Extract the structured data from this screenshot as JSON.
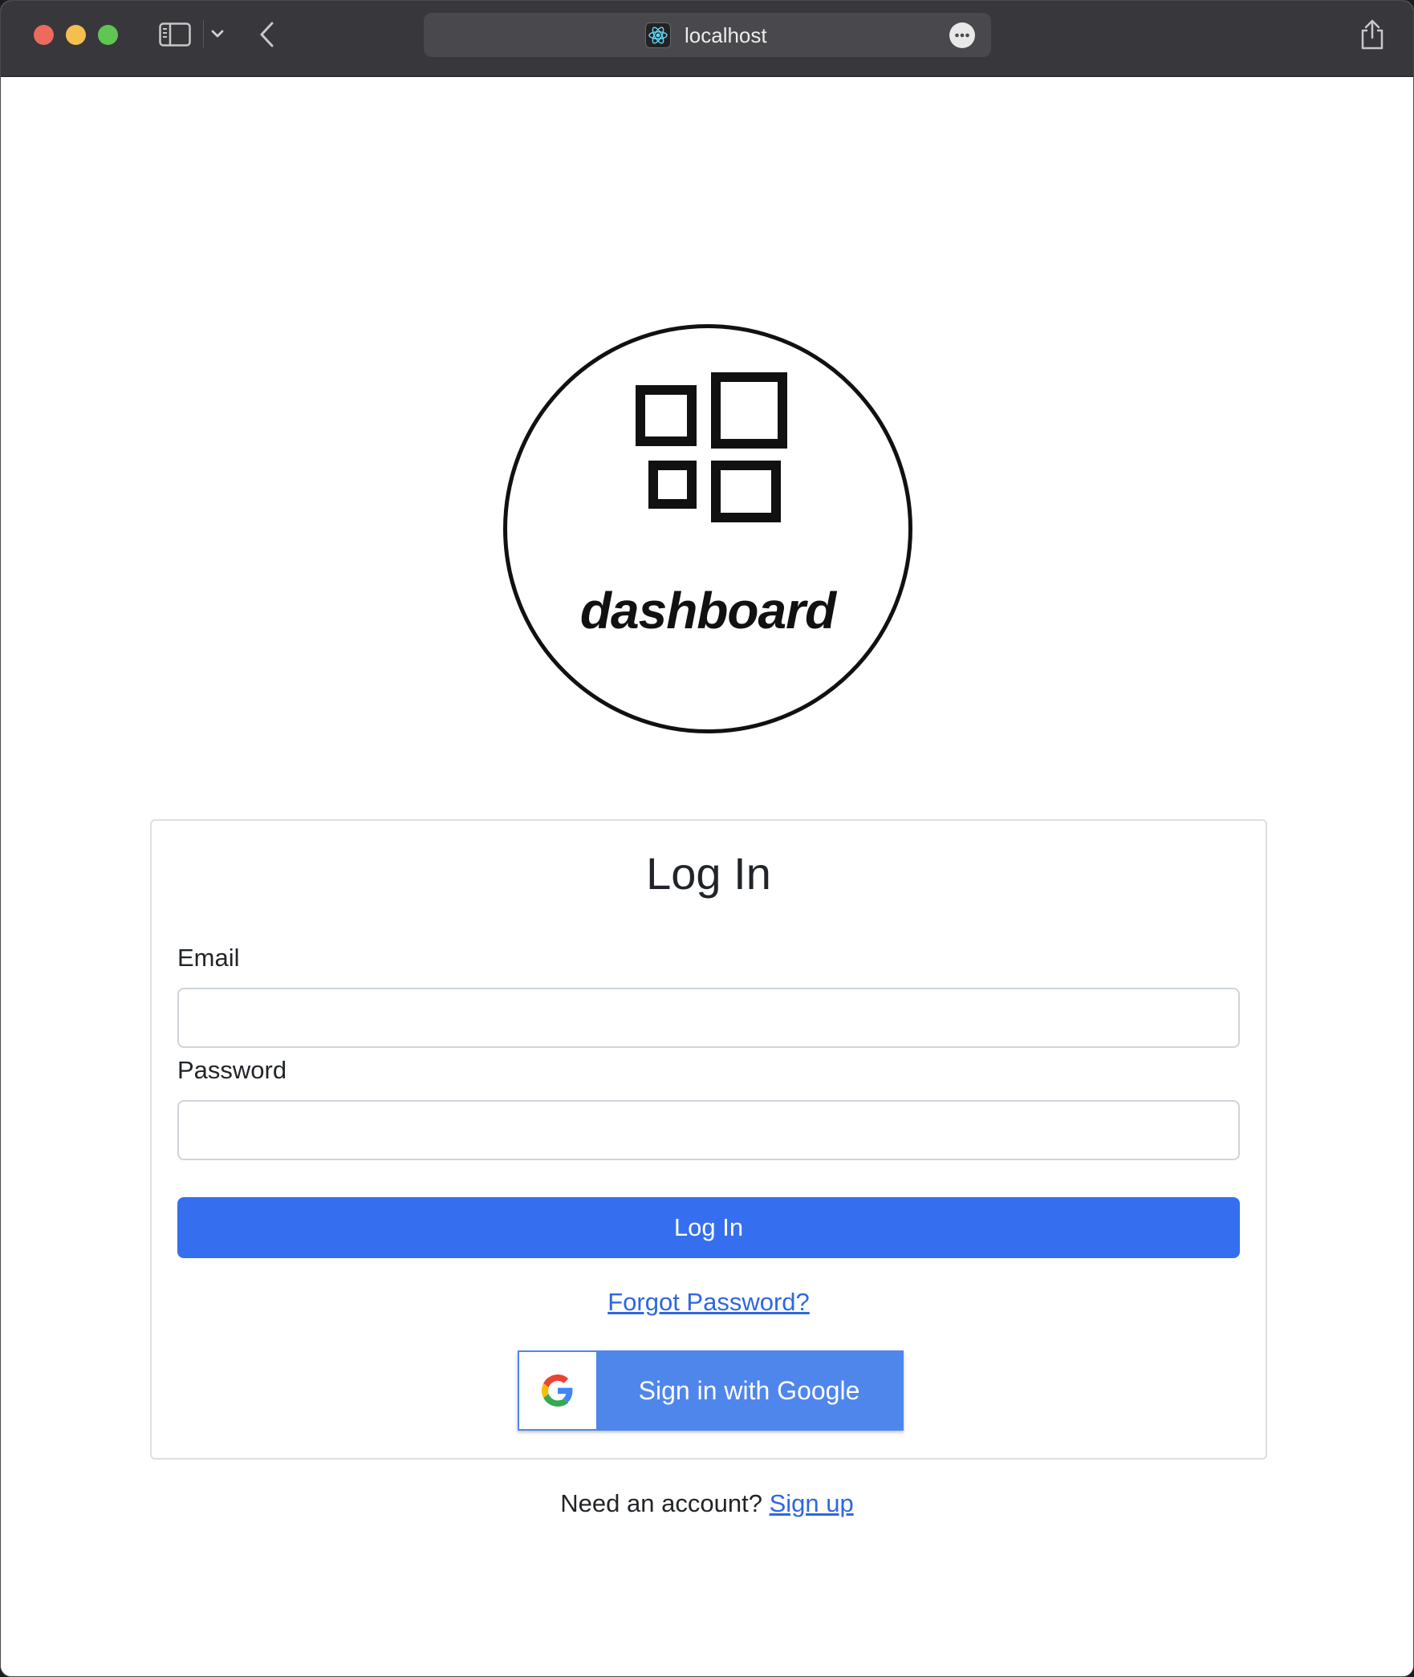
{
  "browser": {
    "url": "localhost"
  },
  "logo": {
    "text": "dashboard"
  },
  "login": {
    "title": "Log In",
    "email_label": "Email",
    "email_value": "",
    "password_label": "Password",
    "password_value": "",
    "submit_label": "Log In",
    "forgot_label": "Forgot Password?",
    "google_label": "Sign in with Google"
  },
  "footer": {
    "prompt": "Need an account?",
    "signup_label": "Sign up"
  },
  "colors": {
    "primary": "#356ff0",
    "google_button": "#4f86ec",
    "link": "#2f67e0"
  }
}
